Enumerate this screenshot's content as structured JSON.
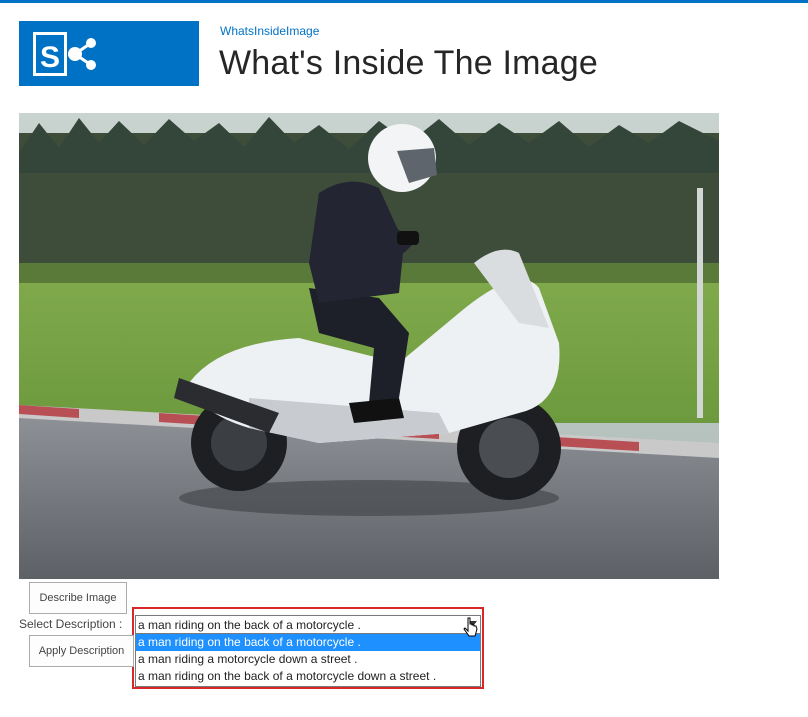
{
  "header": {
    "site_link": "WhatsInsideImage",
    "title": "What's Inside The Image"
  },
  "logo": {
    "icon": "sharepoint-logo",
    "color": "#0072c6"
  },
  "image": {
    "alt": "Person in white helmet and dark clothing riding a white scooter on a track",
    "icon": "photo"
  },
  "controls": {
    "describe_label": "Describe Image",
    "select_label": "Select Description :",
    "selected_value": "a man riding on the back of a motorcycle .",
    "apply_label": "Apply Description",
    "options": [
      "a man riding on the back of a motorcycle .",
      "a man riding a motorcycle down a street .",
      "a man riding on the back of a motorcycle down a street ."
    ]
  },
  "colors": {
    "accent": "#0072c6",
    "highlight_border": "#d9262b",
    "selected_option": "#1e90ff"
  }
}
